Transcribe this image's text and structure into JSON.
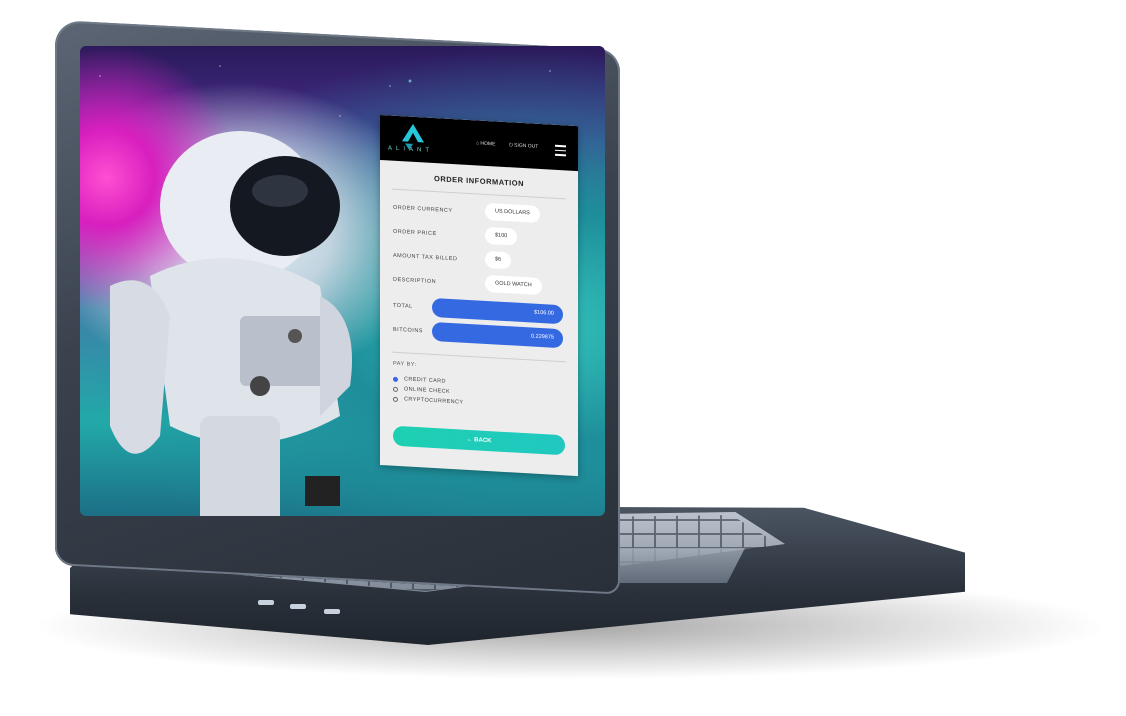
{
  "header": {
    "logo_text": "ALIANT",
    "nav_home": "HOME",
    "nav_signout": "SIGN OUT"
  },
  "order": {
    "title": "ORDER INFORMATION",
    "fields": [
      {
        "label": "ORDER CURRENCY",
        "value": "US DOLLARS"
      },
      {
        "label": "ORDER PRICE",
        "value": "$100"
      },
      {
        "label": "AMOUNT TAX BILLED",
        "value": "$6"
      },
      {
        "label": "DESCRIPTION",
        "value": "GOLD WATCH"
      }
    ],
    "total_label": "TOTAL",
    "total_value": "$106.00",
    "bitcoins_label": "BITCOINS",
    "bitcoins_value": "0.229875"
  },
  "payment": {
    "heading": "PAY BY:",
    "options": [
      {
        "label": "CREDIT CARD",
        "selected": true
      },
      {
        "label": "ONLINE CHECK",
        "selected": false
      },
      {
        "label": "CRYPTOCURRENCY",
        "selected": false
      }
    ],
    "back_label": "← BACK"
  },
  "colors": {
    "accent_blue": "#3569e2",
    "back_teal": "#1ed0b2",
    "topbar": "#000000"
  }
}
